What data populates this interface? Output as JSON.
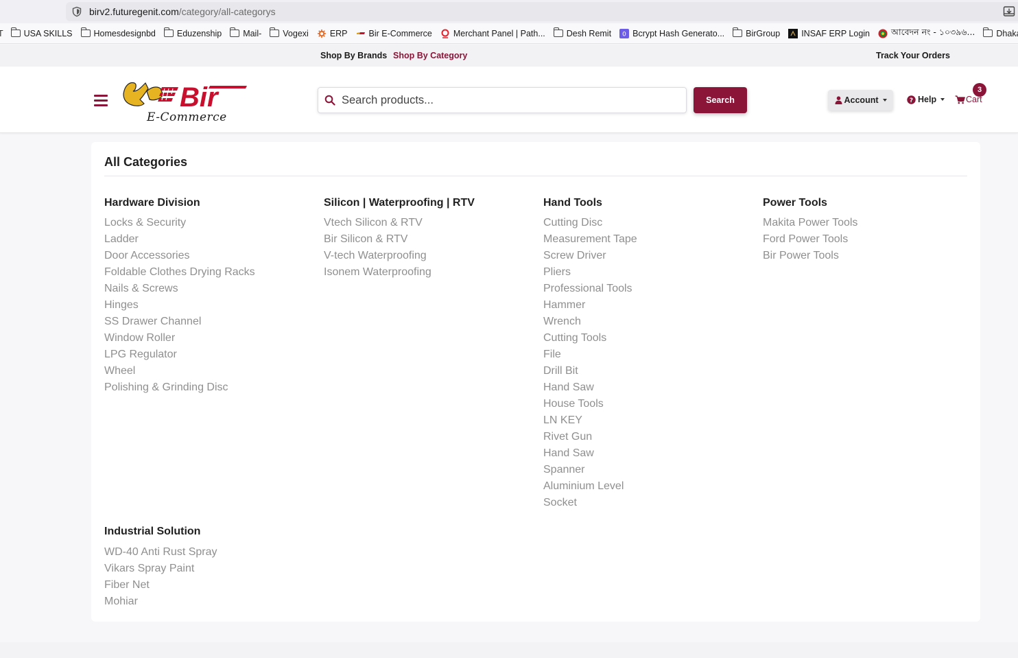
{
  "browser": {
    "url_host": "birv2.futuregenit.com",
    "url_path": "/category/all-categorys"
  },
  "bookmarks": [
    {
      "label": "USA SKILLS",
      "icon": "folder-icon"
    },
    {
      "label": "Homesdesignbd",
      "icon": "folder-icon"
    },
    {
      "label": "Eduzenship",
      "icon": "folder-icon"
    },
    {
      "label": "Mail-",
      "icon": "folder-icon"
    },
    {
      "label": "Vogexi",
      "icon": "folder-icon"
    },
    {
      "label": "ERP",
      "icon": "erp-favicon"
    },
    {
      "label": "Bir E-Commerce",
      "icon": "bir-favicon"
    },
    {
      "label": "Merchant Panel | Path...",
      "icon": "pathao-favicon"
    },
    {
      "label": "Desh Remit",
      "icon": "folder-icon"
    },
    {
      "label": "Bcrypt Hash Generato...",
      "icon": "bcrypt-favicon"
    },
    {
      "label": "BirGroup",
      "icon": "folder-icon"
    },
    {
      "label": "INSAF ERP Login",
      "icon": "insaf-favicon"
    },
    {
      "label": "আবেদন নং - ১০৩৯৬...",
      "icon": "bd-gov-favicon"
    },
    {
      "label": "Dhaka Rangers",
      "icon": "folder-icon"
    }
  ],
  "topbar": {
    "brands": "Shop By Brands",
    "category": "Shop By Category",
    "track": "Track Your Orders"
  },
  "header": {
    "logo_text": "Bir",
    "logo_sub": "E-Commerce",
    "search_placeholder": "Search products...",
    "search_button": "Search",
    "account": "Account",
    "help": "Help",
    "cart": "Cart",
    "cart_count": "3"
  },
  "colors": {
    "brand": "#8a1538",
    "link_gray": "#8f8f8f"
  },
  "page": {
    "title": "All Categories"
  },
  "categories": [
    {
      "title": "Hardware Division",
      "items": [
        "Locks & Security",
        "Ladder",
        "Door Accessories",
        "Foldable Clothes Drying Racks",
        "Nails & Screws",
        "Hinges",
        "SS Drawer Channel",
        "Window Roller",
        "LPG Regulator",
        "Wheel",
        "Polishing & Grinding Disc"
      ]
    },
    {
      "title": "Silicon | Waterproofing | RTV",
      "items": [
        "Vtech Silicon & RTV",
        "Bir Silicon & RTV",
        "V-tech Waterproofing",
        "Isonem Waterproofing"
      ]
    },
    {
      "title": "Hand Tools",
      "items": [
        "Cutting Disc",
        "Measurement Tape",
        "Screw Driver",
        "Pliers",
        "Professional Tools",
        "Hammer",
        "Wrench",
        "Cutting Tools",
        "File",
        "Drill Bit",
        "Hand Saw",
        "House Tools",
        "LN KEY",
        "Rivet Gun",
        "Hand Saw",
        "Spanner",
        "Aluminium Level",
        "Socket"
      ]
    },
    {
      "title": "Power Tools",
      "items": [
        "Makita Power Tools",
        "Ford Power Tools",
        "Bir Power Tools"
      ]
    },
    {
      "title": "Industrial Solution",
      "items": [
        "WD-40 Anti Rust Spray",
        "Vikars Spray Paint",
        "Fiber Net",
        "Mohiar"
      ]
    }
  ]
}
